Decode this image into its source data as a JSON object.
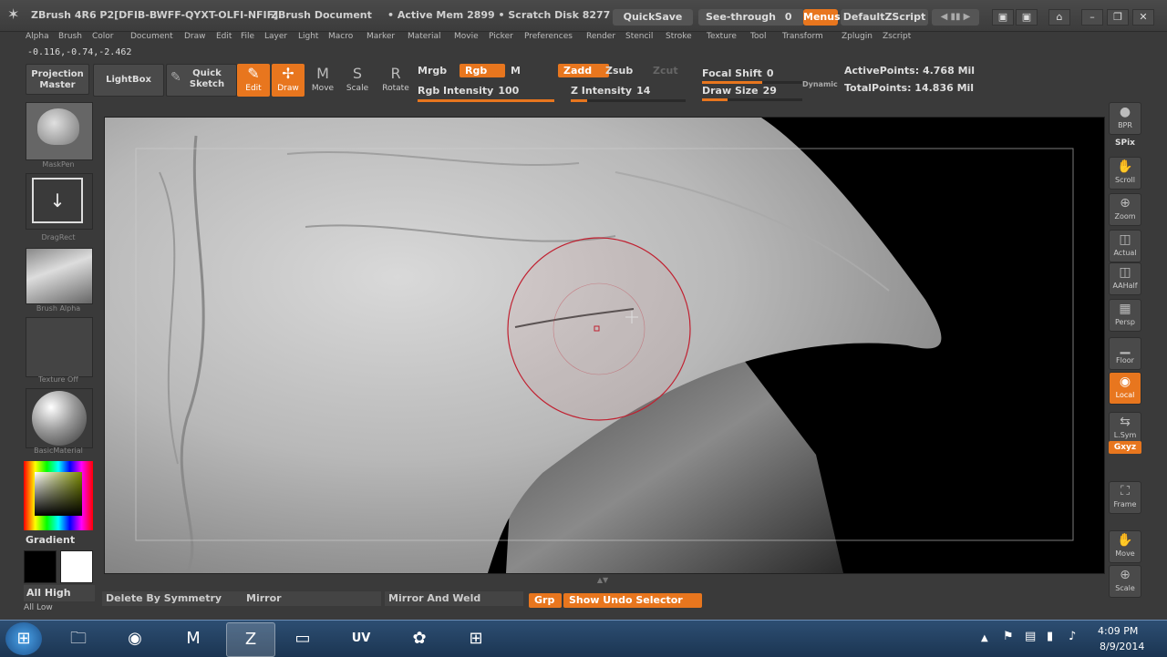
{
  "title_bar": {
    "app_version": "ZBrush 4R6 P2[DFIB-BWFF-QYXT-OLFI-NFIF]",
    "document": "ZBrush Document",
    "active_mem": "• Active Mem 2899 • Scratch Disk 8277",
    "quicksave": "QuickSave",
    "see_through_label": "See-through",
    "see_through_value": "0",
    "menus": "Menus",
    "default_zscript": "DefaultZScript",
    "win_min": "–",
    "win_restore": "❐",
    "win_close": "✕"
  },
  "menu_bar": [
    "Alpha",
    "Brush",
    "Color",
    "Document",
    "Draw",
    "Edit",
    "File",
    "Layer",
    "Light",
    "Macro",
    "Marker",
    "Material",
    "Movie",
    "Picker",
    "Preferences",
    "Render",
    "Stencil",
    "Stroke",
    "Texture",
    "Tool",
    "Transform",
    "Zplugin",
    "Zscript"
  ],
  "coordinates": "-0.116,-0.74,-2.462",
  "toolbar": {
    "projection_master": "Projection Master",
    "lightbox": "LightBox",
    "quick_sketch": "Quick Sketch",
    "tools": [
      {
        "label": "Edit",
        "glyph": "✎"
      },
      {
        "label": "Draw",
        "glyph": "✢"
      },
      {
        "label": "Move",
        "glyph": "M"
      },
      {
        "label": "Scale",
        "glyph": "S"
      },
      {
        "label": "Rotate",
        "glyph": "R"
      }
    ],
    "mrgb": "Mrgb",
    "rgb": "Rgb",
    "m": "M",
    "zadd": "Zadd",
    "zsub": "Zsub",
    "zcut": "Zcut",
    "rgb_intensity_label": "Rgb Intensity",
    "rgb_intensity_value": "100",
    "rgb_intensity_fill": 1.0,
    "z_intensity_label": "Z Intensity",
    "z_intensity_value": "14",
    "z_intensity_fill": 0.14,
    "focal_shift_label": "Focal Shift",
    "focal_shift_value": "0",
    "draw_size_label": "Draw Size",
    "draw_size_value": "29",
    "dynamic": "Dynamic",
    "active_points": "ActivePoints: 4.768 Mil",
    "total_points": "TotalPoints: 14.836 Mil"
  },
  "left_shelf": {
    "mask_pen": "MaskPen",
    "drag_rect": "DragRect",
    "brush_alpha": "Brush Alpha",
    "texture_off": "Texture Off",
    "basic_material": "BasicMaterial",
    "gradient": "Gradient",
    "all_high": "All High",
    "all_low": "All Low",
    "accent": "#e8761e"
  },
  "right_shelf": [
    {
      "label": "BPR",
      "glyph": "●",
      "on": false
    },
    {
      "label": "SPix",
      "glyph": "",
      "on": false
    },
    {
      "label": "Scroll",
      "glyph": "✋",
      "on": false
    },
    {
      "label": "Zoom",
      "glyph": "⊕",
      "on": false
    },
    {
      "label": "Actual",
      "glyph": "◫",
      "on": false
    },
    {
      "label": "AAHalf",
      "glyph": "◫",
      "on": false
    },
    {
      "label": "Persp",
      "glyph": "▦",
      "on": false
    },
    {
      "label": "Floor",
      "glyph": "▁",
      "on": false
    },
    {
      "label": "Local",
      "glyph": "◉",
      "on": true
    },
    {
      "label": "L.Sym",
      "glyph": "⇆",
      "on": false
    },
    {
      "label": "Gxyz",
      "glyph": "",
      "on": true
    },
    {
      "label": "Frame",
      "glyph": "⛶",
      "on": false
    },
    {
      "label": "Move",
      "glyph": "✋",
      "on": false
    },
    {
      "label": "Scale",
      "glyph": "⊕",
      "on": false
    }
  ],
  "bottom_bar": {
    "delete_by_symmetry": "Delete By Symmetry",
    "mirror": "Mirror",
    "mirror_and_weld": "Mirror And Weld",
    "grp": "Grp",
    "show_undo_selector": "Show Undo Selector"
  },
  "taskbar": {
    "icons": [
      {
        "name": "explorer-icon",
        "glyph": "🗀"
      },
      {
        "name": "chrome-icon",
        "glyph": "◉"
      },
      {
        "name": "maya-icon",
        "glyph": "M"
      },
      {
        "name": "zbrush-icon",
        "glyph": "Z"
      },
      {
        "name": "screen-icon",
        "glyph": "▭"
      },
      {
        "name": "uvlayout-icon",
        "glyph": "UV"
      },
      {
        "name": "flower-icon",
        "glyph": "✿"
      },
      {
        "name": "network-app-icon",
        "glyph": "⊞"
      }
    ],
    "time": "4:09 PM",
    "date": "8/9/2014"
  }
}
